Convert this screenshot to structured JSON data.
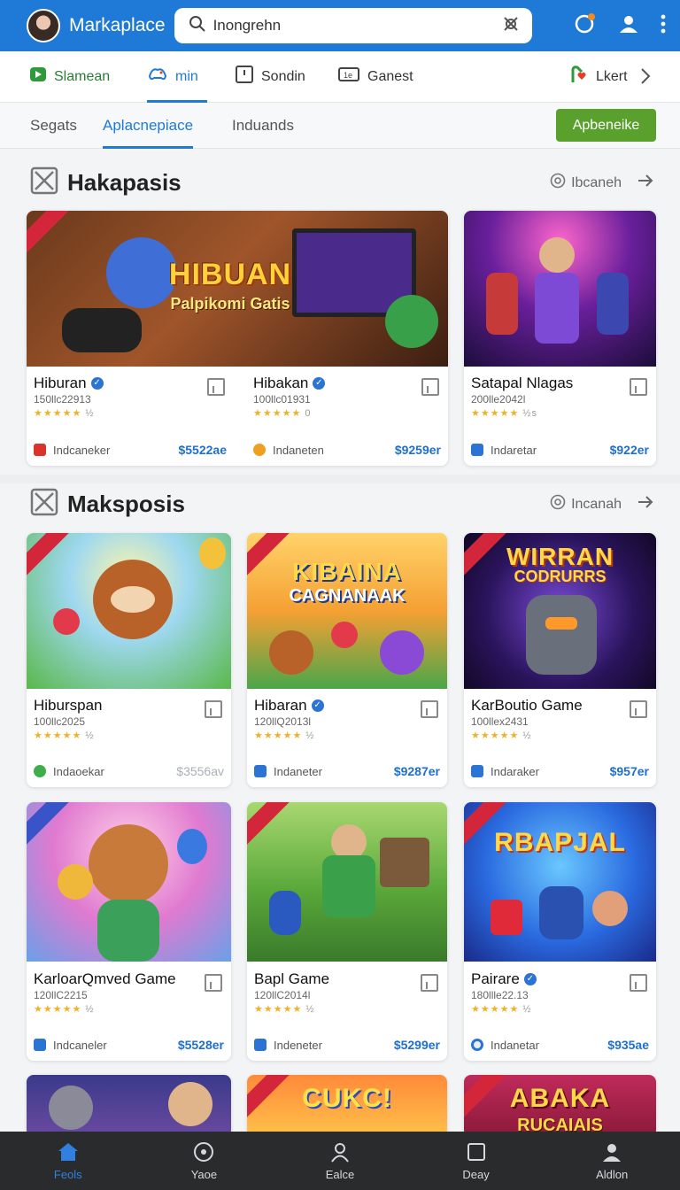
{
  "app": {
    "title": "Markaplace",
    "search_value": "Inongrehn"
  },
  "category_tabs": [
    {
      "label": "Slamean",
      "icon": "play-icon",
      "active": false
    },
    {
      "label": "min",
      "icon": "controller-icon",
      "active": true
    },
    {
      "label": "Sondin",
      "icon": "bookmark-square-icon",
      "active": false
    },
    {
      "label": "Ganest",
      "icon": "console-icon",
      "active": false
    },
    {
      "label": "Lkert",
      "icon": "heart-tag-icon",
      "active": false
    }
  ],
  "sub_tabs": [
    {
      "label": "Segats",
      "active": false
    },
    {
      "label": "Aplacnepiace",
      "active": true
    },
    {
      "label": "Induands",
      "active": false
    }
  ],
  "primary_button": "Apbeneike",
  "sections": [
    {
      "title": "Hakapasis",
      "see_more": "Ibcaneh",
      "cards": [
        {
          "title": "Hiburan",
          "verified": true,
          "sub": "150llc22913",
          "rating_tail": "½",
          "developer": "Indcaneker",
          "price": "$5522ae",
          "price_muted": false,
          "art_title": "HIBUAN",
          "art_sub": "Palpikomi Gatis"
        },
        {
          "title": "Hibakan",
          "verified": true,
          "sub": "100llc01931",
          "rating_tail": "0",
          "developer": "Indaneten",
          "price": "$9259er",
          "price_muted": false,
          "art_title": "",
          "art_sub": ""
        },
        {
          "title": "Satapal Nlagas",
          "verified": false,
          "sub": "200lle2042l",
          "rating_tail": "½s",
          "developer": "Indaretar",
          "price": "$922er",
          "price_muted": false,
          "art_title": "",
          "art_sub": ""
        }
      ]
    },
    {
      "title": "Maksposis",
      "see_more": "Incanah",
      "cards": [
        {
          "title": "Hiburspan",
          "verified": false,
          "sub": "100llc2025",
          "rating_tail": "½",
          "developer": "Indaoekar",
          "price": "$3556av",
          "price_muted": true,
          "art_title": "",
          "art_sub": ""
        },
        {
          "title": "Hibaran",
          "verified": true,
          "sub": "120llQ2013l",
          "rating_tail": "½",
          "developer": "Indaneter",
          "price": "$9287er",
          "price_muted": false,
          "art_title": "KIBAINA",
          "art_sub": "CAGNANAAK"
        },
        {
          "title": "KarBoutio Game",
          "verified": false,
          "sub": "100llex2431",
          "rating_tail": "½",
          "developer": "Indaraker",
          "price": "$957er",
          "price_muted": false,
          "art_title": "WIRRAN",
          "art_sub": "CODRURRS"
        },
        {
          "title": "KarloarQmved Game",
          "verified": false,
          "sub": "120llC2215",
          "rating_tail": "½",
          "developer": "Indcaneler",
          "price": "$5528er",
          "price_muted": false,
          "art_title": "",
          "art_sub": ""
        },
        {
          "title": "Bapl Game",
          "verified": false,
          "sub": "120llC2014l",
          "rating_tail": "½",
          "developer": "Indeneter",
          "price": "$5299er",
          "price_muted": false,
          "art_title": "",
          "art_sub": ""
        },
        {
          "title": "Pairare",
          "verified": true,
          "sub": "180llle22.13",
          "rating_tail": "½",
          "developer": "Indanetar",
          "price": "$935ae",
          "price_muted": false,
          "art_title": "RBAPJAL",
          "art_sub": ""
        },
        {
          "title": "",
          "verified": false,
          "sub": "",
          "rating_tail": "",
          "developer": "",
          "price": "",
          "price_muted": false,
          "art_title": "",
          "art_sub": ""
        },
        {
          "title": "",
          "verified": false,
          "sub": "",
          "rating_tail": "",
          "developer": "",
          "price": "",
          "price_muted": false,
          "art_title": "CUKC!",
          "art_sub": ""
        },
        {
          "title": "",
          "verified": false,
          "sub": "",
          "rating_tail": "",
          "developer": "",
          "price": "",
          "price_muted": false,
          "art_title": "ABAKA",
          "art_sub": "RUCAIAIS"
        }
      ]
    }
  ],
  "bottom_nav": [
    {
      "label": "Feols",
      "icon": "home-icon",
      "active": true
    },
    {
      "label": "Yaoe",
      "icon": "compass-icon",
      "active": false
    },
    {
      "label": "Ealce",
      "icon": "person-icon",
      "active": false
    },
    {
      "label": "Deay",
      "icon": "square-icon",
      "active": false
    },
    {
      "label": "Aldlon",
      "icon": "account-icon",
      "active": false
    }
  ],
  "colors": {
    "brand_blue": "#1e7ad6",
    "accent_green": "#5aa02c",
    "price_blue": "#1e6fd0",
    "star_gold": "#f0b127",
    "nav_bg": "#2a2b2d"
  }
}
